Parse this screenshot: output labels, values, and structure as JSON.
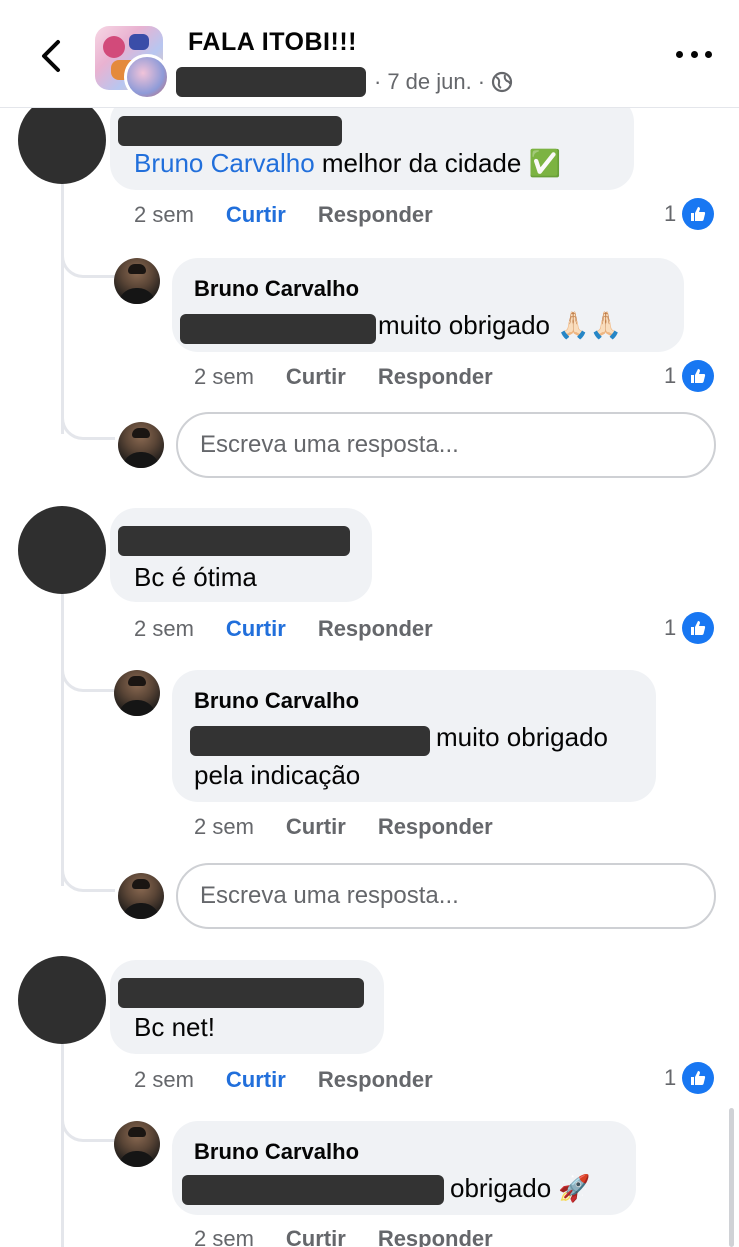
{
  "header": {
    "title": "FALA ITOBI!!!",
    "date": "7 de jun.",
    "separator": "·"
  },
  "comments": [
    {
      "mention": "Bruno Carvalho",
      "text": "melhor da cidade ✅",
      "time": "2 sem",
      "like_label": "Curtir",
      "reply_label": "Responder",
      "likes": "1",
      "liked": true,
      "reply": {
        "author": "Bruno Carvalho",
        "text": "muito obrigado 🙏🏻🙏🏻",
        "time": "2 sem",
        "like_label": "Curtir",
        "reply_label": "Responder",
        "likes": "1"
      },
      "reply_placeholder": "Escreva uma resposta..."
    },
    {
      "text": "Bc é ótima",
      "time": "2 sem",
      "like_label": "Curtir",
      "reply_label": "Responder",
      "likes": "1",
      "liked": true,
      "reply": {
        "author": "Bruno Carvalho",
        "text_line1": "muito obrigado",
        "text_line2": "pela indicação",
        "time": "2 sem",
        "like_label": "Curtir",
        "reply_label": "Responder"
      },
      "reply_placeholder": "Escreva uma resposta..."
    },
    {
      "text": "Bc net!",
      "time": "2 sem",
      "like_label": "Curtir",
      "reply_label": "Responder",
      "likes": "1",
      "liked": true,
      "reply": {
        "author": "Bruno Carvalho",
        "text": "obrigado 🚀",
        "time": "2 sem",
        "like_label": "Curtir",
        "reply_label": "Responder"
      }
    }
  ],
  "colors": {
    "accent": "#216fdb",
    "like": "#1877f2",
    "bubble": "#f0f2f5",
    "muted": "#65676b",
    "redaction": "#333333"
  }
}
